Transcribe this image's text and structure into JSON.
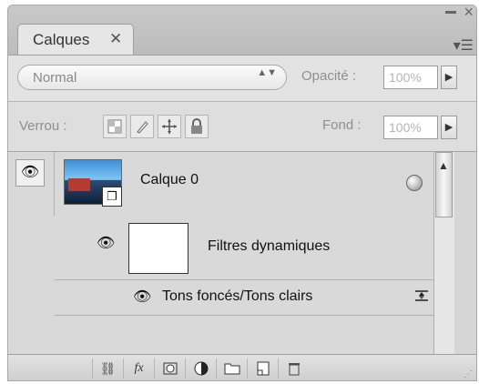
{
  "panel": {
    "tab_label": "Calques",
    "tab_close": "✕",
    "window_close": "×",
    "panel_menu": "▾☰"
  },
  "options_row": {
    "blend_mode": "Normal",
    "blend_arrows": "▲▼",
    "opacity_label": "Opacité :",
    "opacity_value": "100%",
    "opacity_button": "▶"
  },
  "lock_row": {
    "lock_label": "Verrou :",
    "fill_label": "Fond :",
    "fill_value": "100%",
    "fill_button": "▶",
    "lock_icons": [
      "lock-transparent-pixels-icon",
      "lock-image-pixels-icon",
      "lock-position-icon",
      "lock-all-icon"
    ]
  },
  "layers": [
    {
      "name": "Calque 0",
      "visible": true,
      "thumbnail": "photo-thumbnail",
      "badge": "smart-object-icon",
      "smart_filters": {
        "label": "Filtres dynamiques",
        "items": [
          {
            "name": "Tons foncés/Tons clairs",
            "options_icon": "filter-blending-options-icon"
          }
        ]
      }
    }
  ],
  "bottom_toolbar": {
    "buttons": [
      "link-layers-icon",
      "layer-style-fx-icon",
      "add-mask-icon",
      "adjustment-layer-icon",
      "new-group-icon",
      "new-layer-icon",
      "delete-layer-icon"
    ]
  }
}
